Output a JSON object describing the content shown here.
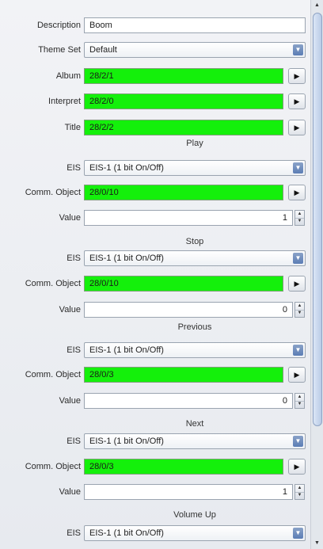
{
  "description": {
    "label": "Description",
    "value": "Boom"
  },
  "theme_set": {
    "label": "Theme Set",
    "value": "Default"
  },
  "album": {
    "label": "Album",
    "value": "28/2/1"
  },
  "interpret": {
    "label": "Interpret",
    "value": "28/2/0"
  },
  "title": {
    "label": "Title",
    "value": "28/2/2"
  },
  "sections": [
    {
      "heading": "Play",
      "eis_label": "EIS",
      "eis_value": "EIS-1 (1 bit On/Off)",
      "comm_label": "Comm. Object",
      "comm_value": "28/0/10",
      "value_label": "Value",
      "value": "1"
    },
    {
      "heading": "Stop",
      "eis_label": "EIS",
      "eis_value": "EIS-1 (1 bit On/Off)",
      "comm_label": "Comm. Object",
      "comm_value": "28/0/10",
      "value_label": "Value",
      "value": "0"
    },
    {
      "heading": "Previous",
      "eis_label": "EIS",
      "eis_value": "EIS-1 (1 bit On/Off)",
      "comm_label": "Comm. Object",
      "comm_value": "28/0/3",
      "value_label": "Value",
      "value": "0"
    },
    {
      "heading": "Next",
      "eis_label": "EIS",
      "eis_value": "EIS-1 (1 bit On/Off)",
      "comm_label": "Comm. Object",
      "comm_value": "28/0/3",
      "value_label": "Value",
      "value": "1"
    },
    {
      "heading": "Volume Up",
      "eis_label": "EIS",
      "eis_value": "EIS-1 (1 bit On/Off)"
    }
  ],
  "icons": {
    "combo_arrow": "▼",
    "assign_arrow": "▶",
    "spin_up": "▲",
    "spin_down": "▼"
  },
  "colors": {
    "address_fill": "#14f00b"
  }
}
